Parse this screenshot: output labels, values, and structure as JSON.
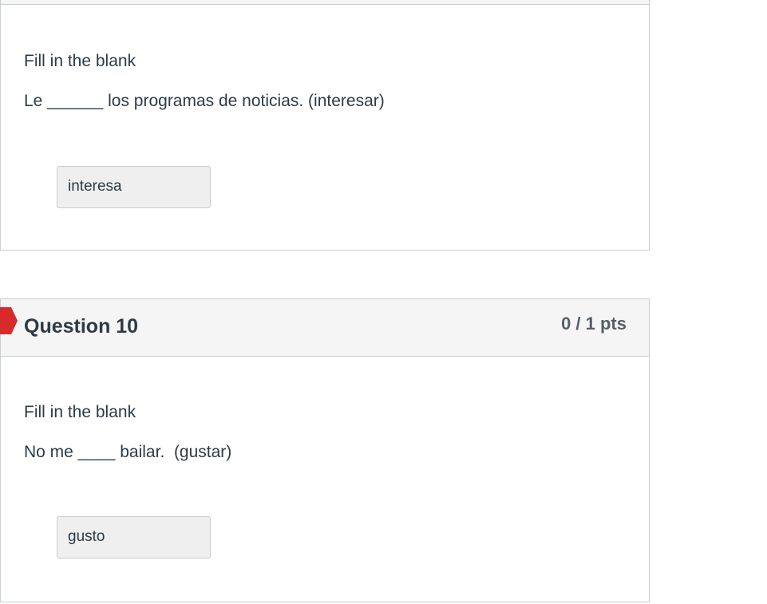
{
  "previous_question": {
    "instruction": "Fill in the blank",
    "prompt": "Le ______ los programas de noticias. (interesar)",
    "answer": "interesa"
  },
  "question_10": {
    "title": "Question 10",
    "points": "0 / 1 pts",
    "status": "incorrect",
    "status_color": "#d82a2a",
    "instruction": "Fill in the blank",
    "prompt": "No me ____ bailar.  (gustar)",
    "answer": "gusto"
  }
}
